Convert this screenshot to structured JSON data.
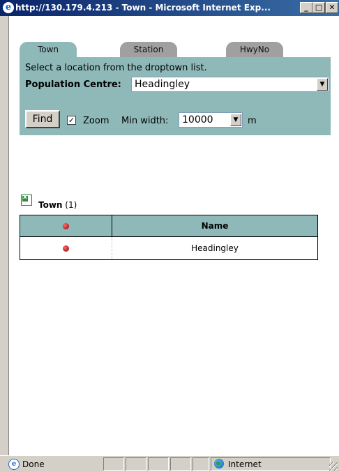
{
  "window": {
    "title": "http://130.179.4.213 - Town - Microsoft Internet Exp...",
    "minimize": "_",
    "maximize": "□",
    "close": "✕"
  },
  "tabs": [
    {
      "label": "Town",
      "active": true
    },
    {
      "label": "Station",
      "active": false
    },
    {
      "label": "HwyNo",
      "active": false
    }
  ],
  "search": {
    "instruction": "Select a location from the droptown list.",
    "population_label": "Population Centre:",
    "population_value": "Headingley",
    "find_label": "Find",
    "zoom_checked": true,
    "zoom_label": "Zoom",
    "min_width_label": "Min width:",
    "min_width_value": "10000",
    "unit": "m"
  },
  "results": {
    "title": "Town",
    "count": "(1)",
    "columns": [
      "",
      "Name"
    ],
    "rows": [
      {
        "name": "Headingley"
      }
    ]
  },
  "status": {
    "text": "Done",
    "zone": "Internet"
  },
  "colors": {
    "panel": "#8fb9b9",
    "titlebar": "#0a246a",
    "marker": "#8b0000"
  }
}
